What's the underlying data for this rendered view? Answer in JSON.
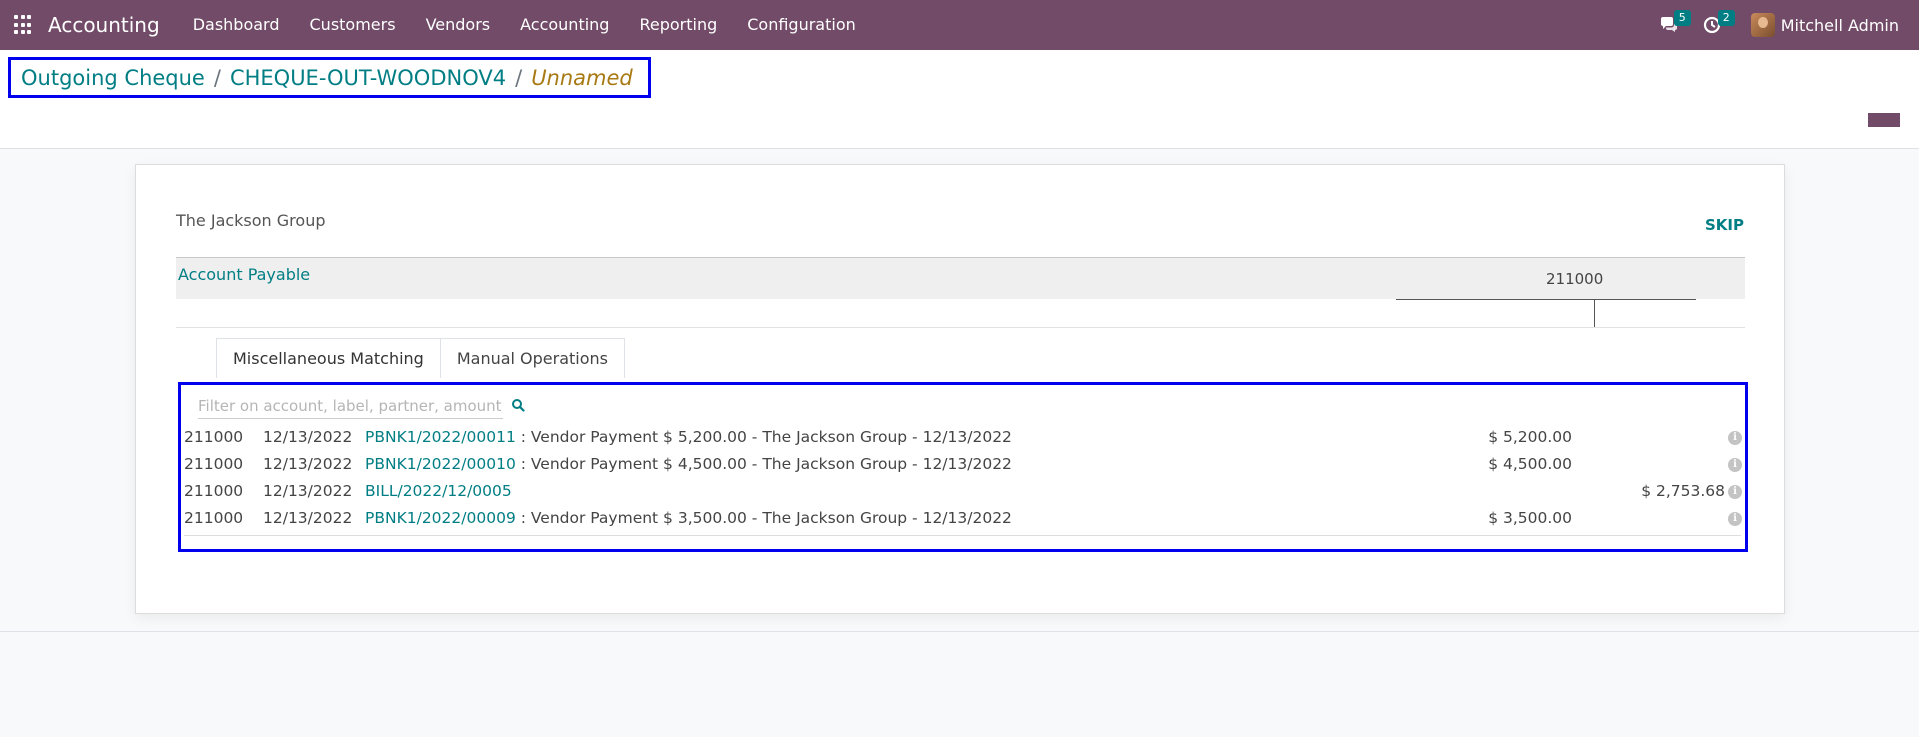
{
  "navbar": {
    "brand": "Accounting",
    "menu": [
      "Dashboard",
      "Customers",
      "Vendors",
      "Accounting",
      "Reporting",
      "Configuration"
    ],
    "messages_count": "5",
    "activities_count": "2",
    "user_name": "Mitchell Admin"
  },
  "breadcrumb": {
    "items": [
      "Outgoing Cheque",
      "CHEQUE-OUT-WOODNOV4"
    ],
    "separator": "/",
    "active": "Unnamed"
  },
  "reconcile": {
    "partner": "The Jackson Group",
    "skip_label": "SKIP",
    "account_name": "Account Payable",
    "account_code": "211000",
    "tabs": [
      "Miscellaneous Matching",
      "Manual Operations"
    ],
    "search_placeholder": "Filter on account, label, partner, amount,",
    "lines": [
      {
        "account": "211000",
        "date": "12/13/2022",
        "ref": "PBNK1/2022/00011",
        "label": " : Vendor Payment $ 5,200.00 - The Jackson Group - 12/13/2022",
        "debit": "$ 5,200.00",
        "credit": ""
      },
      {
        "account": "211000",
        "date": "12/13/2022",
        "ref": "PBNK1/2022/00010",
        "label": " : Vendor Payment $ 4,500.00 - The Jackson Group - 12/13/2022",
        "debit": "$ 4,500.00",
        "credit": ""
      },
      {
        "account": "211000",
        "date": "12/13/2022",
        "ref": "BILL/2022/12/0005",
        "label": "",
        "debit": "",
        "credit": "$ 2,753.68"
      },
      {
        "account": "211000",
        "date": "12/13/2022",
        "ref": "PBNK1/2022/00009",
        "label": " : Vendor Payment $ 3,500.00 - The Jackson Group - 12/13/2022",
        "debit": "$ 3,500.00",
        "credit": ""
      }
    ]
  },
  "colors": {
    "navbar": "#714b67",
    "link": "#017e84",
    "active_breadcrumb": "#a87a13",
    "highlight_box": "#0000ee"
  }
}
